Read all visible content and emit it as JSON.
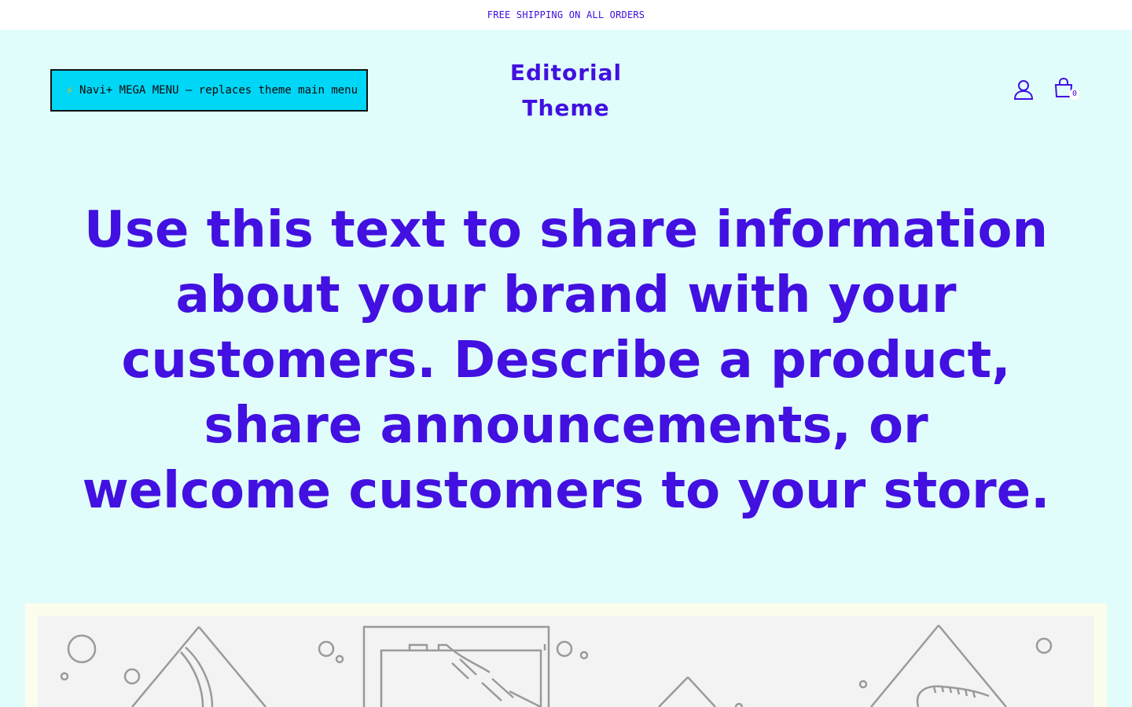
{
  "announcement": {
    "text": "FREE SHIPPING ON ALL ORDERS"
  },
  "header": {
    "mega_menu_label": "Navi+ MEGA MENU — replaces theme main menu",
    "mega_menu_icon": "lightning-bolt-icon",
    "logo_line1": "Editorial",
    "logo_line2": "Theme",
    "cart_count": "0",
    "icons": [
      "account-icon",
      "cart-icon"
    ]
  },
  "hero": {
    "text": "Use this text to share information about your brand with your customers. Describe a product, share announcements, or welcome customers to your store."
  },
  "colors": {
    "brand": "#4210e0",
    "page_background": "#e0fdfb",
    "menu_background": "#00d6f6",
    "image_frame": "#fdfdee"
  }
}
